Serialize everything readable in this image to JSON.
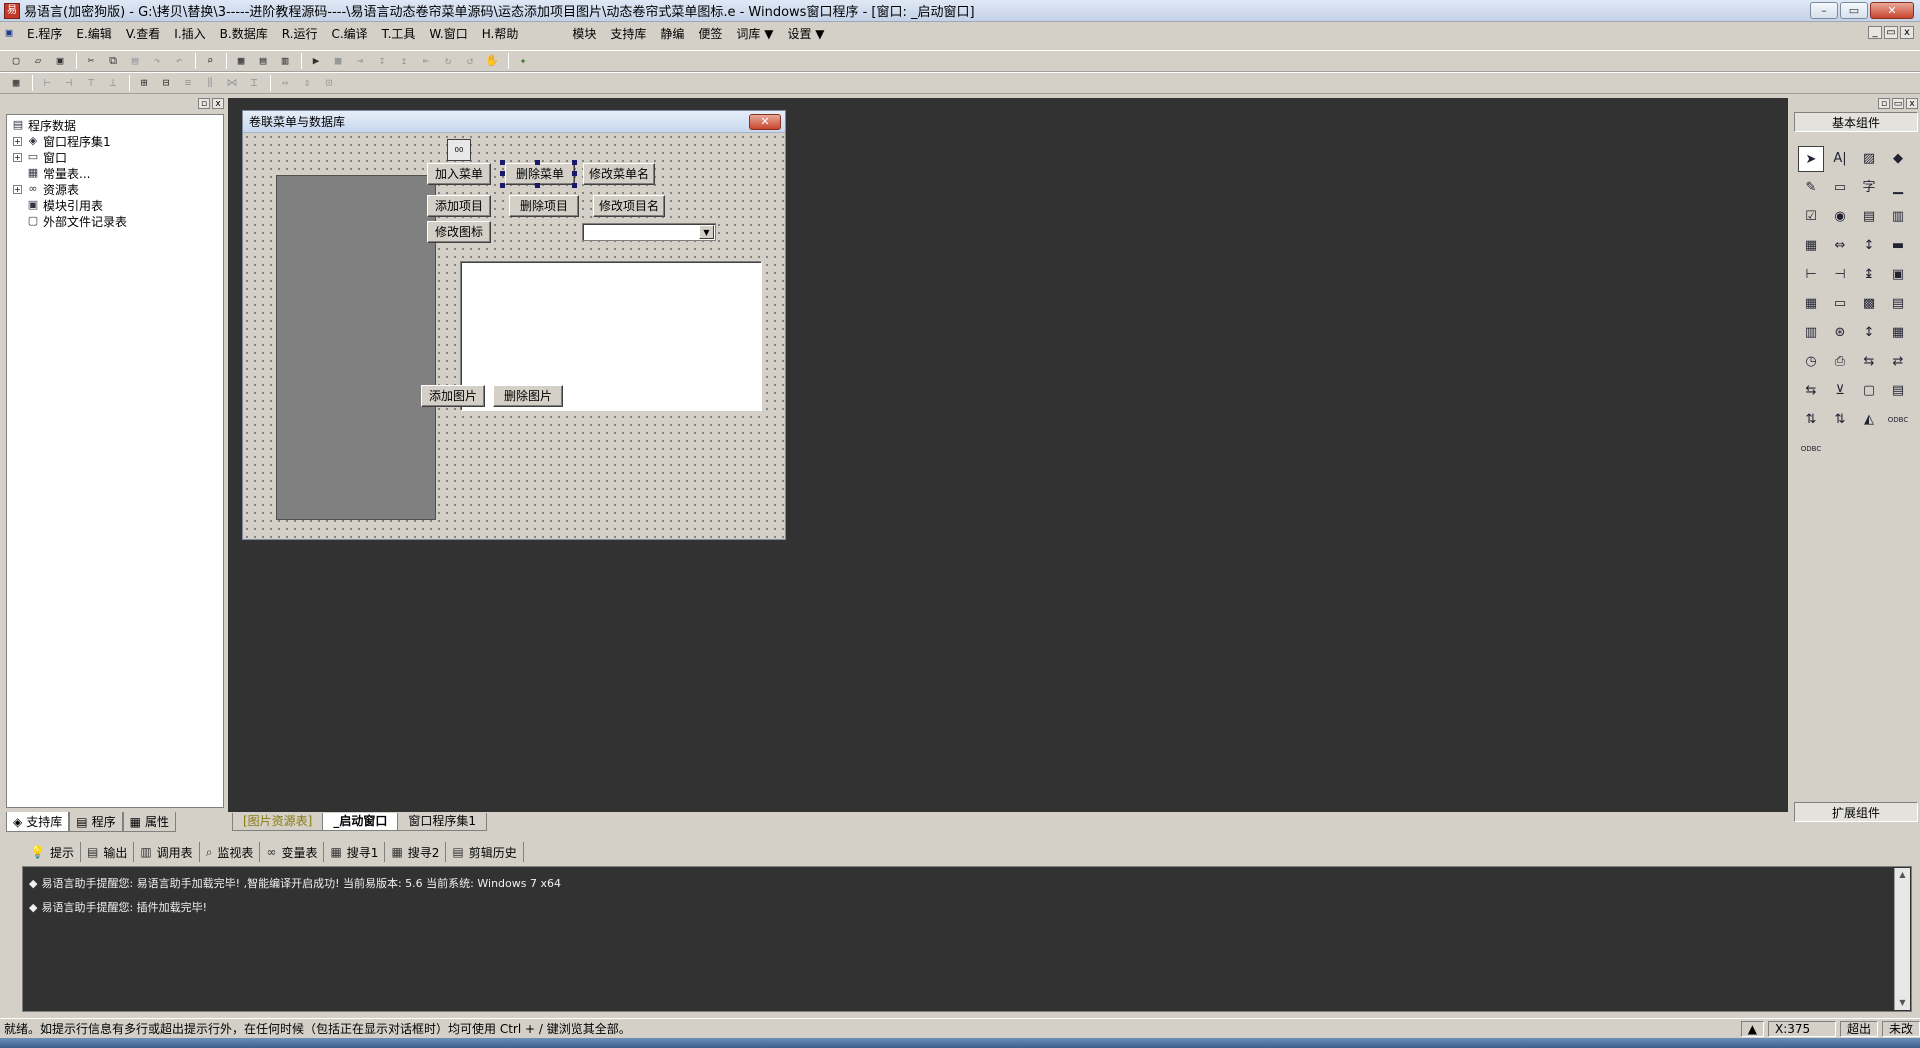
{
  "window": {
    "title": "易语言(加密狗版) - G:\\拷贝\\替换\\3-----进阶教程源码----\\易语言动态卷帘菜单源码\\运态添加项目图片\\动态卷帘式菜单图标.e - Windows窗口程序 - [窗口: _启动窗口]",
    "minimize": "–",
    "maximize": "▭",
    "close": "✕"
  },
  "menu": {
    "items": [
      "E.程序",
      "E.编辑",
      "V.查看",
      "I.插入",
      "B.数据库",
      "R.运行",
      "C.编译",
      "T.工具",
      "W.窗口",
      "H.帮助"
    ],
    "extra": [
      "模块",
      "支持库",
      "静编",
      "便签",
      "词库 ▼",
      "设置 ▼"
    ]
  },
  "left_panel": {
    "tree": [
      {
        "label": "程序数据",
        "icon": "▤",
        "expand": "",
        "indent": 0
      },
      {
        "label": "窗口程序集1",
        "icon": "◈",
        "expand": "+",
        "indent": 1
      },
      {
        "label": "窗口",
        "icon": "▭",
        "expand": "+",
        "indent": 1
      },
      {
        "label": "常量表...",
        "icon": "▦",
        "expand": "",
        "indent": 1
      },
      {
        "label": "资源表",
        "icon": "∞",
        "expand": "+",
        "indent": 1
      },
      {
        "label": "模块引用表",
        "icon": "▣",
        "expand": "",
        "indent": 1
      },
      {
        "label": "外部文件记录表",
        "icon": "▢",
        "expand": "",
        "indent": 1
      }
    ],
    "tabs": [
      {
        "label": "支持库",
        "icon": "◈"
      },
      {
        "label": "程序",
        "icon": "▤"
      },
      {
        "label": "属性",
        "icon": "▦"
      }
    ]
  },
  "form": {
    "title": "卷联菜单与数据库",
    "close": "✕",
    "imagelist_label": "00",
    "buttons": {
      "add_menu": "加入菜单",
      "delete_menu": "删除菜单",
      "rename_menu": "修改菜单名",
      "add_item": "添加项目",
      "delete_item": "删除项目",
      "rename_item": "修改项目名",
      "change_icon": "修改图标",
      "add_image": "添加图片",
      "delete_image": "删除图片"
    },
    "combo_arrow": "▼"
  },
  "design_tabs": [
    "[图片资源表]",
    "_启动窗口",
    "窗口程序集1"
  ],
  "toolbox": {
    "title": "基本组件",
    "extend": "扩展组件",
    "tools": [
      "➤",
      "A|",
      "▨",
      "◆",
      "✎",
      "▭",
      "字",
      "▁",
      "☑",
      "◉",
      "▤",
      "▥",
      "▦",
      "⇔",
      "↕",
      "▬",
      "⊢",
      "⊣",
      "↨",
      "▣",
      "▦",
      "▭",
      "▩",
      "▤",
      "▥",
      "⊛",
      "↕",
      "▦",
      "◷",
      "⎙",
      "⇆",
      "⇄",
      "⇆",
      "⊻",
      "▢",
      "▤",
      "⇅",
      "⇅",
      "◭",
      "ODBC",
      "ODBC"
    ]
  },
  "output": {
    "tabs": [
      {
        "label": "提示",
        "icon": "💡"
      },
      {
        "label": "输出",
        "icon": "▤"
      },
      {
        "label": "调用表",
        "icon": "▥"
      },
      {
        "label": "监视表",
        "icon": "⌕"
      },
      {
        "label": "变量表",
        "icon": "∞"
      },
      {
        "label": "搜寻1",
        "icon": "▦"
      },
      {
        "label": "搜寻2",
        "icon": "▦"
      },
      {
        "label": "剪辑历史",
        "icon": "▤"
      }
    ],
    "lines": [
      "易语言助手提醒您: 易语言助手加载完毕! ,智能编译开启成功! 当前易版本: 5.6 当前系统: Windows 7 x64",
      "易语言助手提醒您: 插件加载完毕!"
    ]
  },
  "status": {
    "text": "就绪。如提示行信息有多行或超出提示行外，在任何时候（包括正在显示对话框时）均可使用 Ctrl + / 键浏览其全部。",
    "coord": "X:375",
    "overwrite": "超出",
    "mode": "未改"
  }
}
